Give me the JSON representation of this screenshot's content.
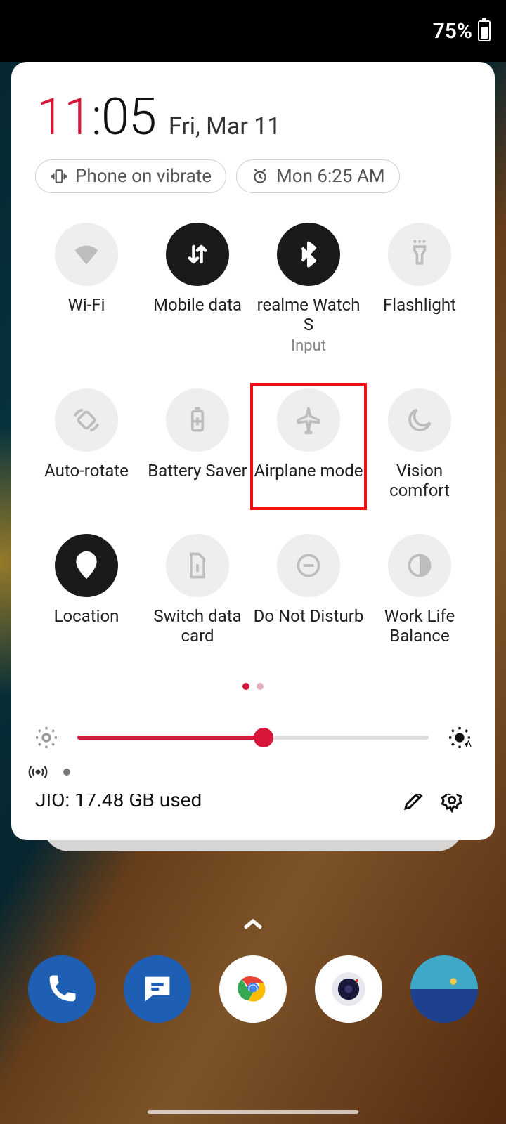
{
  "statusbar": {
    "battery_pct": "75%"
  },
  "clock": {
    "hours": "11",
    "sep": ":",
    "minutes": "05",
    "date": "Fri, Mar 11"
  },
  "chips": {
    "vibrate": "Phone on vibrate",
    "alarm": "Mon 6:25 AM"
  },
  "tiles": [
    {
      "id": "wifi",
      "label": "Wi-Fi",
      "active": false
    },
    {
      "id": "mobiledata",
      "label": "Mobile data",
      "active": true
    },
    {
      "id": "realme",
      "label": "realme Watch S",
      "sub": "Input",
      "active": true
    },
    {
      "id": "flashlight",
      "label": "Flashlight",
      "active": false
    },
    {
      "id": "autorotate",
      "label": "Auto-rotate",
      "active": false
    },
    {
      "id": "battsaver",
      "label": "Battery Saver",
      "active": false
    },
    {
      "id": "airplane",
      "label": "Airplane mode",
      "active": false,
      "highlighted": true
    },
    {
      "id": "vision",
      "label": "Vision comfort",
      "active": false
    },
    {
      "id": "location",
      "label": "Location",
      "active": true
    },
    {
      "id": "switchsim",
      "label": "Switch data card",
      "active": false
    },
    {
      "id": "dnd",
      "label": "Do Not Disturb",
      "active": false
    },
    {
      "id": "worklife",
      "label": "Work Life Balance",
      "active": false
    }
  ],
  "brightness": {
    "value_pct": 53
  },
  "footer": {
    "usage": "JIO: 17.48 GB used"
  },
  "dock": {
    "apps": [
      "phone",
      "messages",
      "chrome",
      "camera",
      "photos"
    ]
  }
}
